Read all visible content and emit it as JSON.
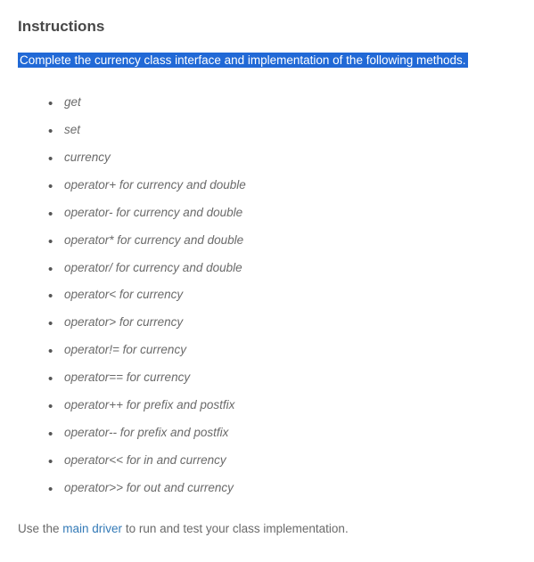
{
  "heading": "Instructions",
  "intro": "Complete the currency class interface and implementation of the following methods.   ",
  "methods": [
    "get",
    "set",
    "currency",
    "operator+ for currency and double",
    "operator- for currency and double",
    "operator* for currency and double",
    "operator/ for currency and double",
    "operator< for currency",
    "operator> for currency",
    "operator!= for currency",
    "operator== for currency",
    "operator++ for prefix and postfix",
    "operator-- for prefix and postfix",
    "operator<< for in and currency",
    "operator>> for out and currency"
  ],
  "footer": {
    "prefix": "Use the ",
    "link_text": "main driver",
    "suffix": " to run and test your class implementation."
  }
}
